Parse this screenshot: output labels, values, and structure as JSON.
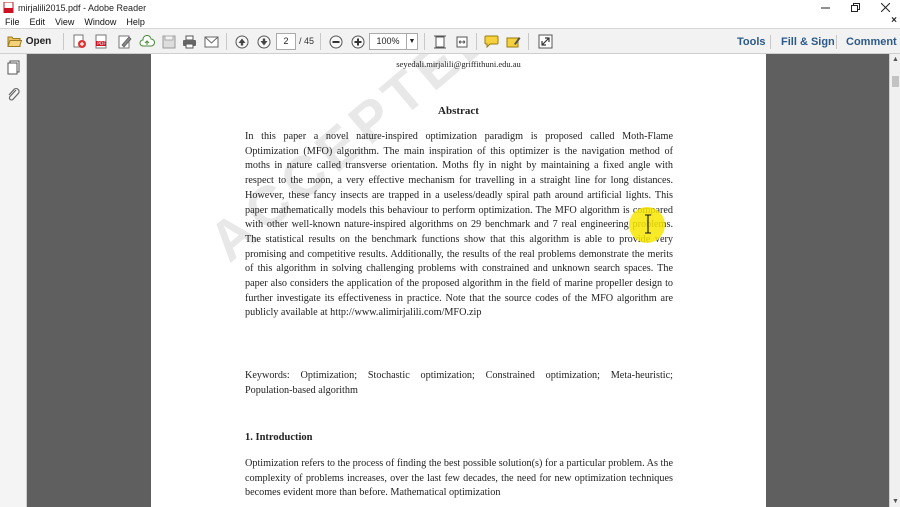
{
  "window": {
    "title": "mirjalili2015.pdf - Adobe Reader",
    "minimize_icon": "minimize-icon",
    "restore_icon": "restore-icon",
    "close_icon": "close-icon"
  },
  "menubar": {
    "items": [
      {
        "label": "File"
      },
      {
        "label": "Edit"
      },
      {
        "label": "View"
      },
      {
        "label": "Window"
      },
      {
        "label": "Help"
      }
    ],
    "close_doc_label": "×"
  },
  "toolbar": {
    "open_label": "Open",
    "page_current": "2",
    "page_total": "/ 45",
    "zoom_value": "100%",
    "right_links": {
      "tools": "Tools",
      "fill_sign": "Fill & Sign",
      "comment": "Comment"
    },
    "accent_color": "#2c5a8a"
  },
  "document": {
    "email": "seyedali.mirjalili@griffithuni.edu.au",
    "abstract_title": "Abstract",
    "abstract_body": "In this paper a novel nature-inspired optimization paradigm is proposed called Moth-Flame Optimization (MFO) algorithm. The main inspiration of this optimizer is the navigation method of moths in nature called transverse orientation. Moths fly in night by maintaining a fixed angle with respect to the moon, a very effective mechanism for travelling in a straight line for long distances. However, these fancy insects are trapped in a useless/deadly spiral path around artificial lights. This paper mathematically models this behaviour to perform optimization. The MFO algorithm is compared with other well-known nature-inspired algorithms on 29 benchmark and 7 real engineering problems. The statistical results on the benchmark functions show that this algorithm is able to provide very promising and competitive results. Additionally, the results of the real problems demonstrate the merits of this algorithm in solving challenging problems with constrained and unknown search spaces. The paper also considers the application of the proposed algorithm in the field of marine propeller design to further investigate its effectiveness in practice. Note that the source codes of the MFO algorithm are publicly available at http://www.alimirjalili.com/MFO.zip",
    "keywords": "Keywords: Optimization; Stochastic optimization; Constrained optimization; Meta-heuristic; Population-based algorithm",
    "intro_heading": "1. Introduction",
    "intro_body": "Optimization refers to the process of finding the best possible solution(s) for a particular problem. As the complexity of problems increases, over the last few decades, the need for new optimization techniques becomes evident more than before. Mathematical optimization",
    "watermark": "ACCEPTED MANUSCRIPT",
    "highlight_color": "#f7e600"
  }
}
